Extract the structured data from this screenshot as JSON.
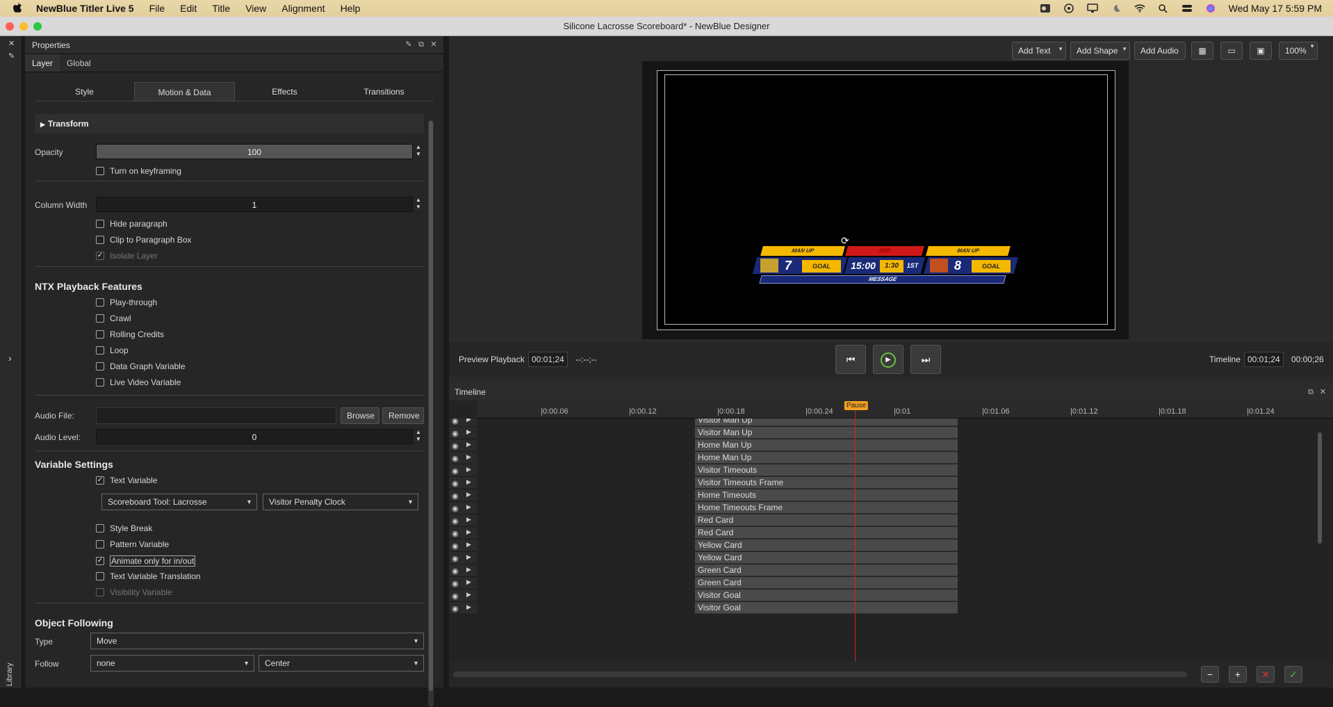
{
  "menubar": {
    "app_name": "NewBlue Titler Live 5",
    "items": [
      "File",
      "Edit",
      "Title",
      "View",
      "Alignment",
      "Help"
    ],
    "clock": "Wed May 17  5:59 PM"
  },
  "window": {
    "title": "Silicone Lacrosse Scoreboard* - NewBlue Designer"
  },
  "properties": {
    "title": "Properties",
    "top_tabs": [
      "Layer",
      "Global"
    ],
    "sub_tabs": [
      "Style",
      "Motion & Data",
      "Effects",
      "Transitions"
    ],
    "transform_label": "Transform",
    "opacity_label": "Opacity",
    "opacity_value": "100",
    "keyframing_label": "Turn on keyframing",
    "column_width_label": "Column Width",
    "column_width_value": "1",
    "hide_paragraph": "Hide paragraph",
    "clip_paragraph": "Clip to Paragraph Box",
    "isolate_layer": "Isolate Layer",
    "ntx_header": "NTX Playback Features",
    "ntx_items": [
      "Play-through",
      "Crawl",
      "Rolling Credits",
      "Loop",
      "Data Graph Variable",
      "Live Video Variable"
    ],
    "audio_file_label": "Audio File:",
    "browse_label": "Browse",
    "remove_label": "Remove",
    "audio_level_label": "Audio Level:",
    "audio_level_value": "0",
    "variable_header": "Variable Settings",
    "text_variable": "Text Variable",
    "scoreboard_tool": "Scoreboard Tool: Lacrosse",
    "variable_select": "Visitor Penalty Clock",
    "style_break": "Style Break",
    "pattern_variable": "Pattern Variable",
    "animate_only": "Animate only for in/out",
    "text_var_translation": "Text Variable Translation",
    "visibility_variable": "Visibility Variable",
    "object_following_header": "Object Following",
    "type_label": "Type",
    "type_value": "Move",
    "follow_label": "Follow",
    "follow_value": "none",
    "anchor_value": "Center",
    "library_label": "Library"
  },
  "toolbar": {
    "add_text": "Add Text",
    "add_shape": "Add Shape",
    "add_audio": "Add Audio",
    "zoom": "100%"
  },
  "scoreboard": {
    "left_tag": "MAN UP",
    "right_tag": "MAN UP",
    "center_tag": "RED",
    "left_score": "7",
    "right_score": "8",
    "goal_left": "GOAL",
    "goal_right": "GOAL",
    "game_clock": "15:00",
    "penalty_clock": "1:30",
    "period": "1ST",
    "message": "MESSAGE"
  },
  "playback": {
    "preview_label": "Preview Playback",
    "preview_time": "00:01;24",
    "preview_end": "--:--;--",
    "timeline_label": "Timeline",
    "timeline_time": "00:01;24",
    "timeline_end": "00:00;26"
  },
  "timeline": {
    "title": "Timeline",
    "pause_label": "Pause",
    "ruler_labels": [
      "0:00.06",
      "0:00.12",
      "0:00.18",
      "0:00.24",
      "0:01",
      "0:01.06",
      "0:01.12",
      "0:01.18",
      "0:01.24"
    ],
    "tracks": [
      "Visitor Man Up",
      "Visitor Man Up",
      "Home Man Up",
      "Home Man Up",
      "Visitor Timeouts",
      "Visitor Timeouts Frame",
      "Home Timeouts",
      "Home Timeouts Frame",
      "Red Card",
      "Red Card",
      "Yellow Card",
      "Yellow Card",
      "Green Card",
      "Green Card",
      "Visitor Goal",
      "Visitor Goal"
    ]
  },
  "colors": {
    "accent_orange": "#f0a020",
    "playhead_red": "#d02020",
    "scoreboard_yellow": "#f5b800",
    "scoreboard_red": "#d01818",
    "scoreboard_navy": "#1a2a78"
  }
}
